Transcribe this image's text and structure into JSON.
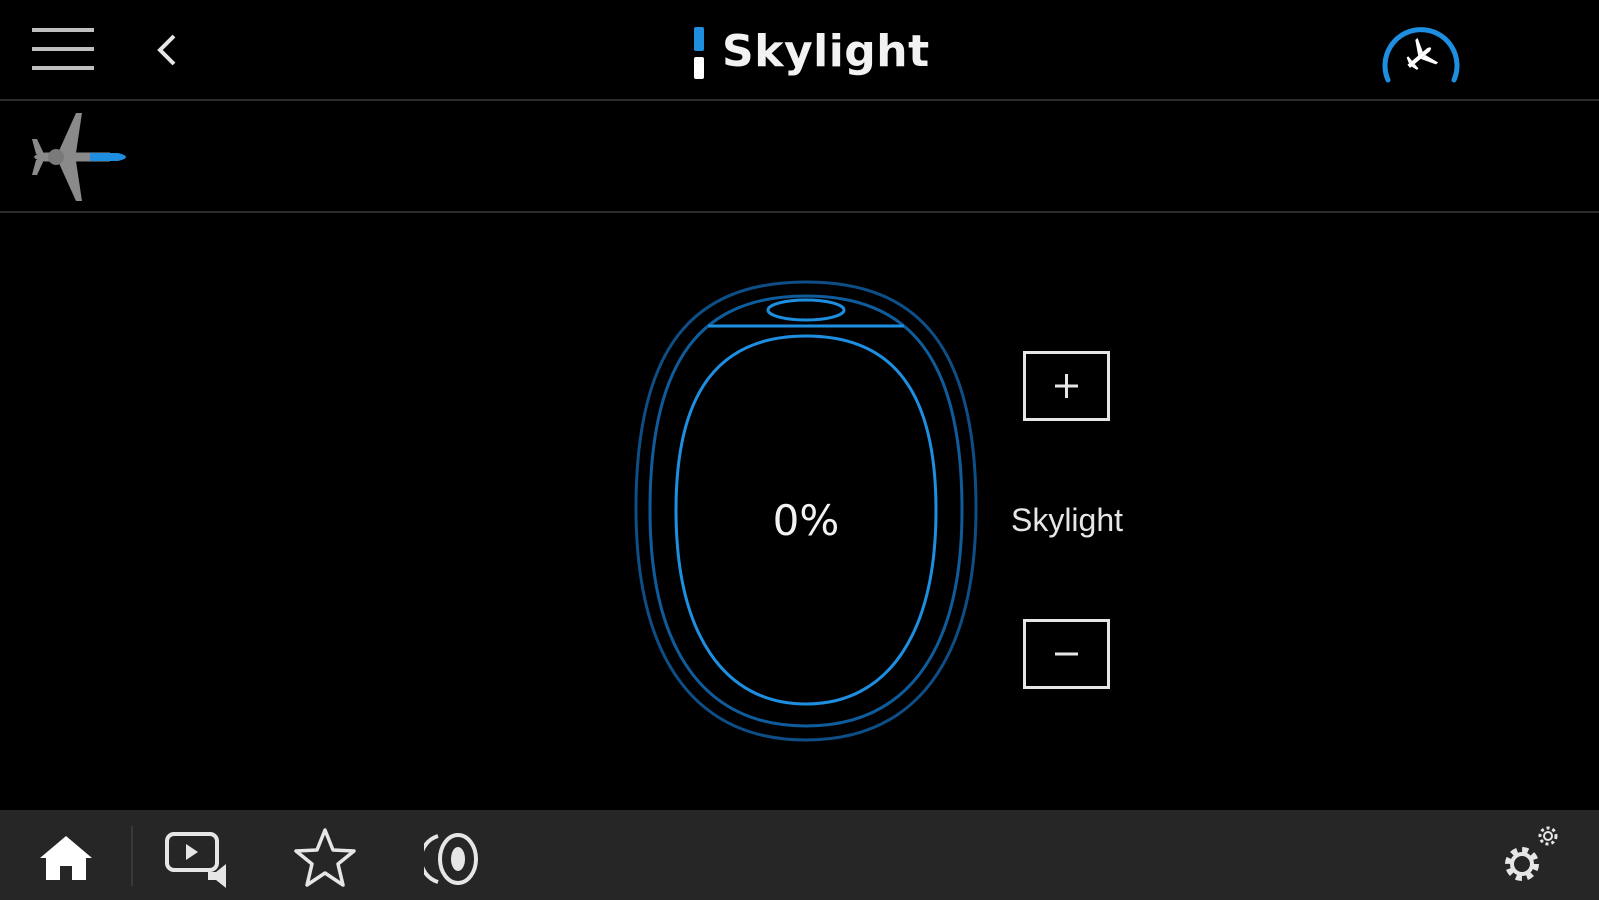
{
  "header": {
    "title": "Skylight",
    "menu_icon": "hamburger-menu-icon",
    "back_icon": "chevron-left-icon",
    "flight_status_icon": "airplane-progress-icon"
  },
  "subheader": {
    "aircraft_icon": "aircraft-top-view-icon"
  },
  "skylight": {
    "value": "0%",
    "label": "Skylight",
    "increase_icon": "plus-icon",
    "decrease_icon": "minus-icon"
  },
  "bottom_nav": {
    "items": [
      {
        "icon": "home-icon"
      },
      {
        "icon": "media-icon"
      },
      {
        "icon": "star-icon"
      },
      {
        "icon": "speaker-icon"
      },
      {
        "icon": "settings-icon"
      }
    ]
  },
  "colors": {
    "accent": "#1e8fe0",
    "window_outline_dark": "#0d4e86",
    "window_outline_bright": "#1e8fe0",
    "background": "#000000",
    "nav_background": "#262626"
  }
}
